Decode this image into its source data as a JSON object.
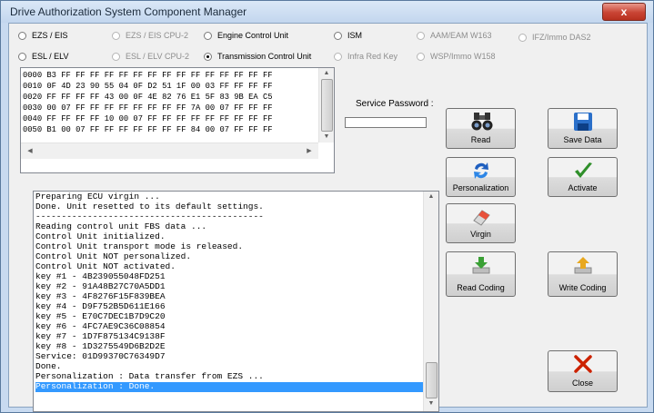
{
  "window": {
    "title": "Drive Authorization System Component Manager",
    "close_label": "x"
  },
  "modules": [
    {
      "label": "EZS / EIS",
      "enabled": true,
      "selected": false
    },
    {
      "label": "EZS / EIS CPU-2",
      "enabled": false,
      "selected": false
    },
    {
      "label": "Engine Control Unit",
      "enabled": true,
      "selected": false
    },
    {
      "label": "ISM",
      "enabled": true,
      "selected": false
    },
    {
      "label": "AAM/EAM W163",
      "enabled": false,
      "selected": false
    },
    {
      "label": "IFZ/Immo DAS2",
      "enabled": false,
      "selected": false
    },
    {
      "label": "ESL / ELV",
      "enabled": true,
      "selected": false
    },
    {
      "label": "ESL / ELV CPU-2",
      "enabled": false,
      "selected": false
    },
    {
      "label": "Transmission Control Unit",
      "enabled": true,
      "selected": true
    },
    {
      "label": "Infra Red Key",
      "enabled": false,
      "selected": false
    },
    {
      "label": "WSP/Immo W158",
      "enabled": false,
      "selected": false
    }
  ],
  "hex_rows": [
    "0000 B3 FF FF FF FF FF FF FF FF FF FF FF FF FF FF FF",
    "0010 0F 4D 23 90 55 04 0F D2 51 1F 00 03 FF FF FF FF",
    "0020 FF FF FF FF 43 00 0F 4E 82 76 E1 5F 83 9B EA C5",
    "0030 00 07 FF FF FF FF FF FF FF FF 7A 00 07 FF FF FF",
    "0040 FF FF FF FF 10 00 07 FF FF FF FF FF FF FF FF FF",
    "0050 B1 00 07 FF FF FF FF FF FF FF 84 00 07 FF FF FF"
  ],
  "service_password": {
    "label": "Service Password :",
    "value": ""
  },
  "log_lines": [
    "Preparing ECU virgin ...",
    "Done. Unit resetted to its default settings.",
    "--------------------------------------------",
    "Reading control unit FBS data ...",
    "Control Unit initialized.",
    "Control Unit transport mode is released.",
    "Control Unit NOT personalized.",
    "Control Unit NOT activated.",
    "key #1 - 4B239055048FD251",
    "key #2 - 91A48B27C70A5DD1",
    "key #3 - 4F8276F15F839BEA",
    "key #4 - D9F752B5D611E166",
    "key #5 - E70C7DEC1B7D9C20",
    "key #6 - 4FC7AE9C36C08854",
    "key #7 - 1D7F875134C9138F",
    "key #8 - 1D3275549D6B2D2E",
    "Service: 01D99370C76349D7",
    "Done.",
    "Personalization : Data transfer from EZS ...",
    "Personalization : Done."
  ],
  "selected_log_line": 19,
  "buttons": {
    "read": "Read",
    "save_data": "Save Data",
    "personalization": "Personalization",
    "activate": "Activate",
    "virgin": "Virgin",
    "read_coding": "Read Coding",
    "write_coding": "Write Coding",
    "close": "Close"
  },
  "icons": {
    "read": "binoculars-icon",
    "save_data": "floppy-disk-icon",
    "personalization": "refresh-arrows-icon",
    "activate": "checkmark-icon",
    "virgin": "eraser-icon",
    "read_coding": "download-arrow-icon",
    "write_coding": "upload-arrow-icon",
    "close": "x-mark-icon"
  },
  "colors": {
    "selection": "#3399ff",
    "close_icon": "#cc2200",
    "check_icon": "#2f8f2a"
  }
}
